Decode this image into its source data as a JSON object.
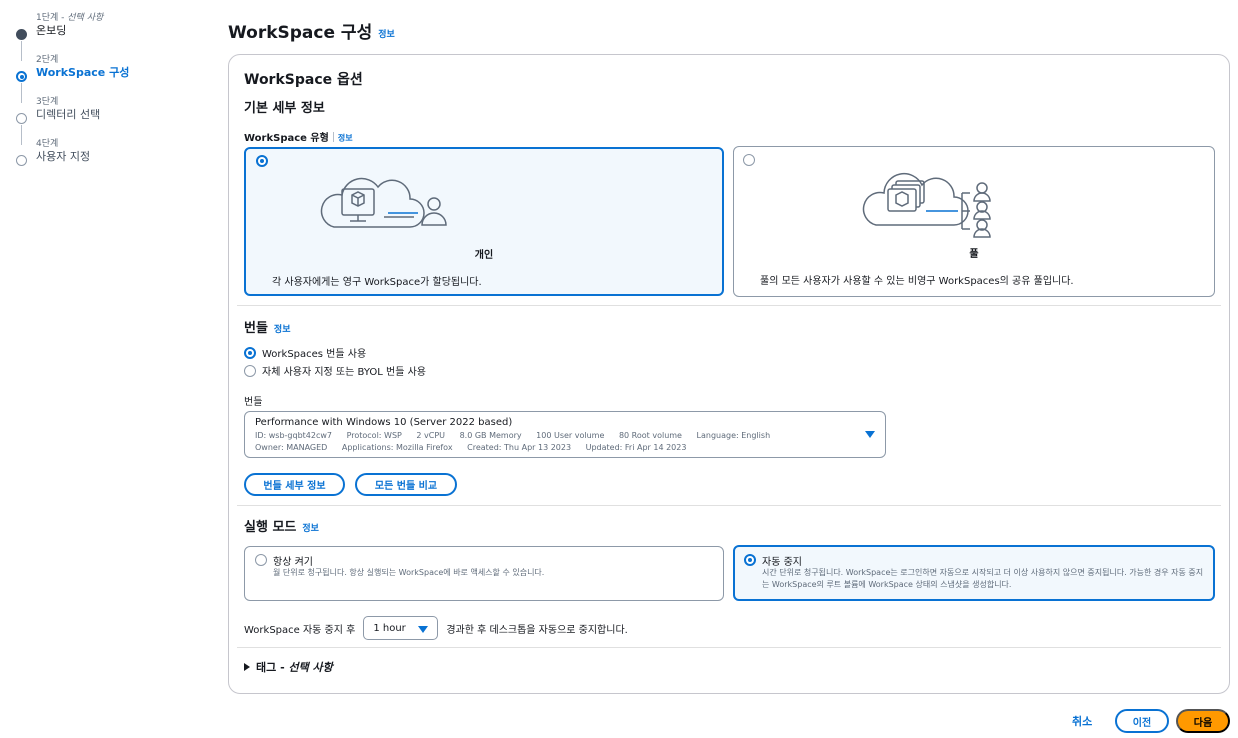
{
  "stepper": {
    "steps": [
      {
        "num": "1단계",
        "optional": "선택 사항",
        "title": "온보딩"
      },
      {
        "num": "2단계",
        "optional": "",
        "title": "WorkSpace 구성"
      },
      {
        "num": "3단계",
        "optional": "",
        "title": "디렉터리 선택"
      },
      {
        "num": "4단계",
        "optional": "",
        "title": "사용자 지정"
      }
    ]
  },
  "header": {
    "title": "WorkSpace 구성",
    "info": "정보"
  },
  "card": {
    "title": "WorkSpace 옵션",
    "basic_details": "기본 세부 정보",
    "type_label": "WorkSpace 유형",
    "info": "정보",
    "type_tiles": [
      {
        "label": "개인",
        "desc": "각 사용자에게는 영구 WorkSpace가 할당됩니다.",
        "selected": true
      },
      {
        "label": "풀",
        "desc": "풀의 모든 사용자가 사용할 수 있는 비영구 WorkSpaces의 공유 풀입니다.",
        "selected": false
      }
    ],
    "bundle": {
      "title": "번들",
      "options": [
        "WorkSpaces 번들 사용",
        "자체 사용자 지정 또는 BYOL 번들 사용"
      ],
      "select_label": "번들",
      "selected_title": "Performance with Windows 10 (Server 2022 based)",
      "line1": [
        "ID: wsb-gqbt42cw7",
        "Protocol: WSP",
        "2 vCPU",
        "8.0 GB Memory",
        "100 User volume",
        "80 Root volume",
        "Language: English"
      ],
      "line2": [
        "Owner: MANAGED",
        "Applications: Mozilla Firefox",
        "Created: Thu Apr 13 2023",
        "Updated: Fri Apr 14 2023"
      ],
      "details_button": "번들 세부 정보",
      "compare_button": "모든 번들 비교"
    },
    "run_mode": {
      "title": "실행 모드",
      "tiles": [
        {
          "title": "항상 켜기",
          "desc": "월 단위로 청구됩니다. 항상 실행되는 WorkSpace에 바로 액세스할 수 있습니다.",
          "selected": false
        },
        {
          "title": "자동 중지",
          "desc": "시간 단위로 청구됩니다. WorkSpace는 로그인하면 자동으로 시작되고 더 이상 사용하지 않으면 중지됩니다. 가능한 경우 자동 중지는 WorkSpace의 루트 볼륨에 WorkSpace 상태의 스냅샷을 생성합니다.",
          "selected": true
        }
      ],
      "auto_stop_prefix": "WorkSpace 자동 중지 후",
      "auto_stop_value": "1 hour",
      "auto_stop_suffix": "경과한 후 데스크톱을 자동으로 중지합니다."
    },
    "tags": {
      "title": "태그",
      "optional": "선택 사항"
    }
  },
  "footer": {
    "cancel": "취소",
    "prev": "이전",
    "next": "다음"
  }
}
